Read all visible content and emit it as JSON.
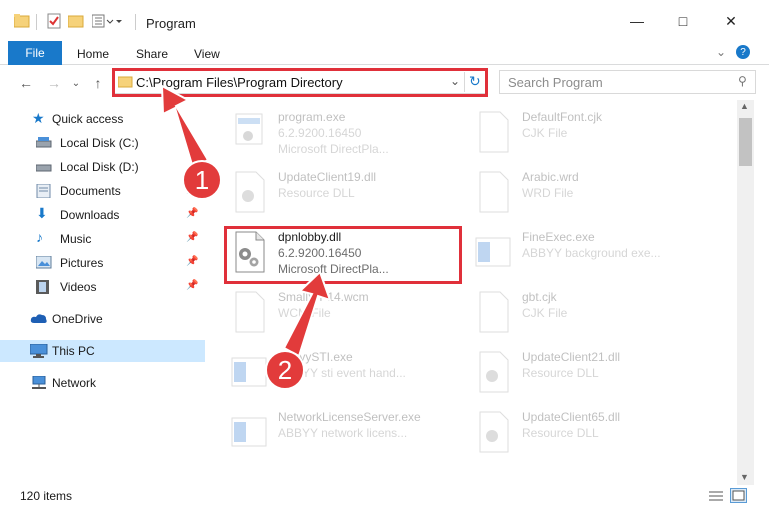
{
  "window": {
    "title": "Program",
    "min_icon": "minimize-icon",
    "max_icon": "maximize-icon",
    "close_icon": "close-icon"
  },
  "ribbon": {
    "file": "File",
    "home": "Home",
    "share": "Share",
    "view": "View"
  },
  "address": {
    "path": "C:\\Program Files\\Program Directory",
    "search_placeholder": "Search Program"
  },
  "sidebar": {
    "items": [
      {
        "label": "Quick access",
        "icon": "star-icon"
      },
      {
        "label": "Local Disk (C:)",
        "icon": "drive-icon"
      },
      {
        "label": "Local Disk (D:)",
        "icon": "drive-icon"
      },
      {
        "label": "Documents",
        "icon": "documents-icon"
      },
      {
        "label": "Downloads",
        "icon": "download-icon"
      },
      {
        "label": "Music",
        "icon": "music-icon"
      },
      {
        "label": "Pictures",
        "icon": "pictures-icon"
      },
      {
        "label": "Videos",
        "icon": "videos-icon"
      },
      {
        "label": "OneDrive",
        "icon": "cloud-icon"
      },
      {
        "label": "This PC",
        "icon": "computer-icon"
      },
      {
        "label": "Network",
        "icon": "network-icon"
      }
    ]
  },
  "files": {
    "program_exe": {
      "name": "program.exe",
      "sub1": "6.2.9200.16450",
      "sub2": "Microsoft DirectPla..."
    },
    "defaultfont": {
      "name": "DefaultFont.cjk",
      "sub1": "CJK File"
    },
    "updateclient19": {
      "name": "UpdateClient19.dll",
      "sub1": "Resource DLL"
    },
    "arabic": {
      "name": "Arabic.wrd",
      "sub1": "WRD File"
    },
    "dpnlobby": {
      "name": "dpnlobby.dll",
      "sub1": "6.2.9200.16450",
      "sub2": "Microsoft DirectPla..."
    },
    "fineexec": {
      "name": "FineExec.exe",
      "sub1": "ABBYY background exe..."
    },
    "smallwp": {
      "name": "SmallWP14.wcm",
      "sub1": "WCM File"
    },
    "gbt": {
      "name": "gbt.cjk",
      "sub1": "CJK File"
    },
    "abbyysti": {
      "name": "AbbyySTI.exe",
      "sub1": "ABBYY sti event hand..."
    },
    "updateclient21": {
      "name": "UpdateClient21.dll",
      "sub1": "Resource DLL"
    },
    "netlicense": {
      "name": "NetworkLicenseServer.exe",
      "sub1": "ABBYY network licens..."
    },
    "updateclient65": {
      "name": "UpdateClient65.dll",
      "sub1": "Resource DLL"
    }
  },
  "status": {
    "items": "120 items"
  },
  "callouts": {
    "one": "1",
    "two": "2"
  },
  "colors": {
    "accent": "#1979ca",
    "highlight": "#e0303a",
    "selected": "#cce8ff"
  }
}
